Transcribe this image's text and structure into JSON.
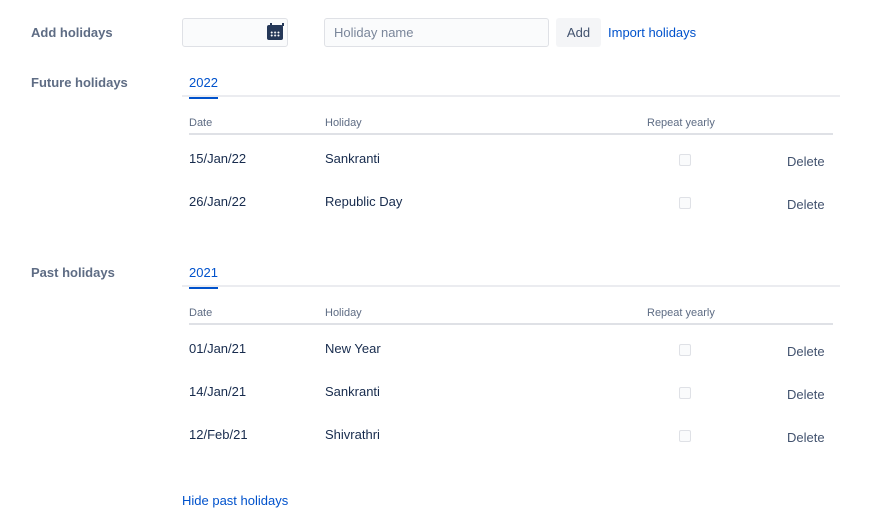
{
  "add": {
    "label": "Add holidays",
    "placeholder": "Holiday name",
    "add_button": "Add",
    "import_link": "Import holidays"
  },
  "future": {
    "label": "Future holidays",
    "tab": "2022",
    "headers": {
      "date": "Date",
      "holiday": "Holiday",
      "repeat": "Repeat yearly"
    },
    "rows": [
      {
        "date": "15/Jan/22",
        "name": "Sankranti",
        "repeat": false,
        "action": "Delete"
      },
      {
        "date": "26/Jan/22",
        "name": "Republic Day",
        "repeat": false,
        "action": "Delete"
      }
    ]
  },
  "past": {
    "label": "Past holidays",
    "tab": "2021",
    "headers": {
      "date": "Date",
      "holiday": "Holiday",
      "repeat": "Repeat yearly"
    },
    "rows": [
      {
        "date": "01/Jan/21",
        "name": "New Year",
        "repeat": false,
        "action": "Delete"
      },
      {
        "date": "14/Jan/21",
        "name": "Sankranti",
        "repeat": false,
        "action": "Delete"
      },
      {
        "date": "12/Feb/21",
        "name": "Shivrathri",
        "repeat": false,
        "action": "Delete"
      }
    ]
  },
  "hide_link": "Hide past holidays"
}
